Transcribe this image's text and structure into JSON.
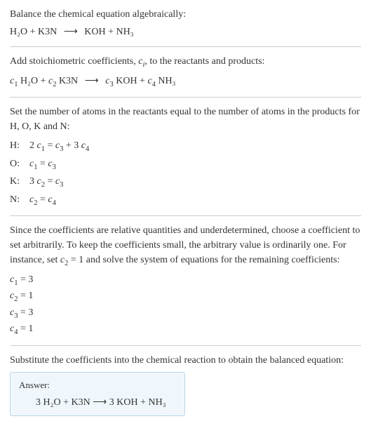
{
  "section1": {
    "title": "Balance the chemical equation algebraically:",
    "equation_lhs": "H₂O + K3N",
    "equation_arrow": "⟶",
    "equation_rhs": "KOH + NH₃"
  },
  "section2": {
    "title_part1": "Add stoichiometric coefficients, ",
    "title_ci": "c",
    "title_ci_sub": "i",
    "title_part2": ", to the reactants and products:",
    "eq_c1": "c",
    "eq_c1_sub": "1",
    "eq_sp1": " H₂O + ",
    "eq_c2": "c",
    "eq_c2_sub": "2",
    "eq_sp2": " K3N ",
    "eq_arrow": "⟶",
    "eq_sp3": " ",
    "eq_c3": "c",
    "eq_c3_sub": "3",
    "eq_sp4": " KOH + ",
    "eq_c4": "c",
    "eq_c4_sub": "4",
    "eq_sp5": " NH₃"
  },
  "section3": {
    "title": "Set the number of atoms in the reactants equal to the number of atoms in the products for H, O, K and N:",
    "rows": {
      "h": {
        "label": "H:",
        "lhs_pre": "2 ",
        "c1": "c",
        "c1s": "1",
        "mid": " = ",
        "c2": "c",
        "c2s": "3",
        "post": " + 3 ",
        "c3": "c",
        "c3s": "4"
      },
      "o": {
        "label": "O:",
        "c1": "c",
        "c1s": "1",
        "mid": " = ",
        "c2": "c",
        "c2s": "3"
      },
      "k": {
        "label": "K:",
        "lhs_pre": "3 ",
        "c1": "c",
        "c1s": "2",
        "mid": " = ",
        "c2": "c",
        "c2s": "3"
      },
      "n": {
        "label": "N:",
        "c1": "c",
        "c1s": "2",
        "mid": " = ",
        "c2": "c",
        "c2s": "4"
      }
    }
  },
  "section4": {
    "text_part1": "Since the coefficients are relative quantities and underdetermined, choose a coefficient to set arbitrarily. To keep the coefficients small, the arbitrary value is ordinarily one. For instance, set ",
    "c2": "c",
    "c2s": "2",
    "text_part2": " = 1 and solve the system of equations for the remaining coefficients:",
    "coeffs": {
      "r1": {
        "c": "c",
        "cs": "1",
        "val": " = 3"
      },
      "r2": {
        "c": "c",
        "cs": "2",
        "val": " = 1"
      },
      "r3": {
        "c": "c",
        "cs": "3",
        "val": " = 3"
      },
      "r4": {
        "c": "c",
        "cs": "4",
        "val": " = 1"
      }
    }
  },
  "section5": {
    "title": "Substitute the coefficients into the chemical reaction to obtain the balanced equation:",
    "answer_label": "Answer:",
    "answer_lhs": "3 H₂O + K3N ",
    "answer_arrow": "⟶",
    "answer_rhs": " 3 KOH + NH₃"
  },
  "chart_data": {
    "type": "table",
    "title": "Chemical equation balancing",
    "unbalanced": "H2O + K3N -> KOH + NH3",
    "atom_equations": [
      {
        "element": "H",
        "equation": "2 c1 = c3 + 3 c4"
      },
      {
        "element": "O",
        "equation": "c1 = c3"
      },
      {
        "element": "K",
        "equation": "3 c2 = c3"
      },
      {
        "element": "N",
        "equation": "c2 = c4"
      }
    ],
    "solution": {
      "c1": 3,
      "c2": 1,
      "c3": 3,
      "c4": 1
    },
    "balanced": "3 H2O + K3N -> 3 KOH + NH3"
  }
}
